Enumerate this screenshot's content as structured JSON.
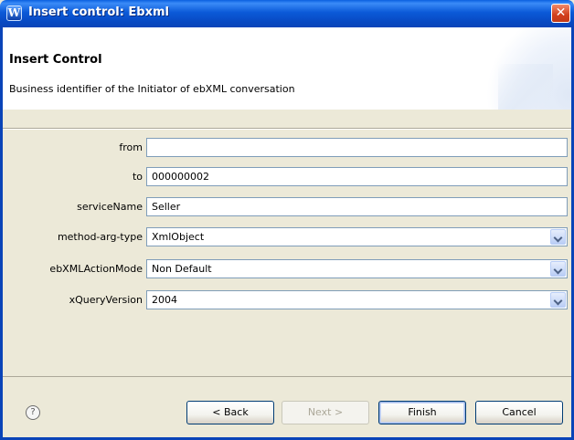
{
  "window": {
    "title": "Insert control: Ebxml",
    "app_icon": "W",
    "close_glyph": "✕"
  },
  "header": {
    "title": "Insert Control",
    "description": "Business identifier of the Initiator of ebXML conversation"
  },
  "form": {
    "rows": [
      {
        "label": "from",
        "value": "",
        "type": "text"
      },
      {
        "label": "to",
        "value": "000000002",
        "type": "text"
      },
      {
        "label": "serviceName",
        "value": "Seller",
        "type": "text"
      },
      {
        "label": "method-arg-type",
        "value": "XmlObject",
        "type": "combo"
      },
      {
        "label": "ebXMLActionMode",
        "value": "Non Default",
        "type": "combo"
      },
      {
        "label": "xQueryVersion",
        "value": "2004",
        "type": "combo"
      }
    ]
  },
  "footer": {
    "help_glyph": "?",
    "back_label": "< Back",
    "next_label": "Next >",
    "finish_label": "Finish",
    "cancel_label": "Cancel"
  }
}
